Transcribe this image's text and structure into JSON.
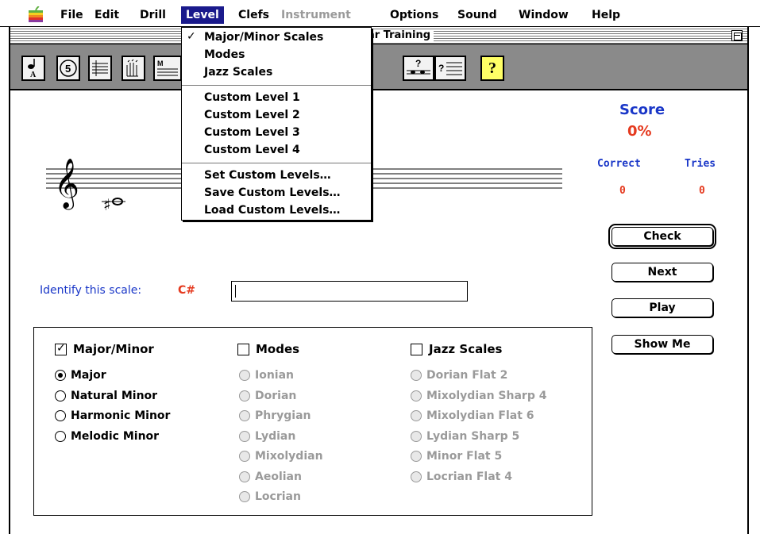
{
  "menubar": {
    "items": [
      {
        "label": "File",
        "state": "normal"
      },
      {
        "label": "Edit",
        "state": "normal"
      },
      {
        "label": "Drill",
        "state": "normal"
      },
      {
        "label": "Level",
        "state": "active"
      },
      {
        "label": "Clefs",
        "state": "normal"
      },
      {
        "label": "Instrument",
        "state": "disabled"
      },
      {
        "label": "Options",
        "state": "normal"
      },
      {
        "label": "Sound",
        "state": "normal"
      },
      {
        "label": "Window",
        "state": "normal"
      },
      {
        "label": "Help",
        "state": "normal"
      }
    ]
  },
  "window": {
    "title_visible": "ar Training"
  },
  "toolbar": {
    "icons": [
      "note-a-icon",
      "interval-5-icon",
      "chord-staff-icon",
      "hand-rhythm-icon",
      "scale-staff-icon",
      "question-staff-icon",
      "question-chord-icon",
      "help-icon"
    ],
    "help_glyph": "?"
  },
  "level_menu": {
    "checked": "Major/Minor Scales",
    "group1": [
      "Major/Minor Scales",
      "Modes",
      "Jazz Scales"
    ],
    "group2": [
      "Custom Level  1",
      "Custom Level  2",
      "Custom Level  3",
      "Custom Level  4"
    ],
    "group3": [
      "Set Custom Levels…",
      "Save Custom Levels…",
      "Load Custom Levels…"
    ]
  },
  "score": {
    "title": "Score",
    "percent": "0%",
    "correct_label": "Correct",
    "tries_label": "Tries",
    "correct": "0",
    "tries": "0"
  },
  "buttons": {
    "check": "Check",
    "next": "Next",
    "play": "Play",
    "show_me": "Show Me"
  },
  "prompt": {
    "label": "Identify this scale:",
    "note": "C#",
    "answer_value": ""
  },
  "categories": {
    "major_minor": {
      "label": "Major/Minor",
      "checked": true,
      "options": [
        "Major",
        "Natural Minor",
        "Harmonic Minor",
        "Melodic Minor"
      ],
      "selected": "Major"
    },
    "modes": {
      "label": "Modes",
      "checked": false,
      "options": [
        "Ionian",
        "Dorian",
        "Phrygian",
        "Lydian",
        "Mixolydian",
        "Aeolian",
        "Locrian"
      ]
    },
    "jazz": {
      "label": "Jazz Scales",
      "checked": false,
      "options": [
        "Dorian Flat 2",
        "Mixolydian Sharp 4",
        "Mixolydian Flat 6",
        "Lydian Sharp 5",
        "Minor Flat 5",
        "Locrian Flat 4"
      ]
    }
  },
  "colors": {
    "blue": "#1a37c8",
    "red": "#e53a1f",
    "menu_highlight": "#1a1a8c",
    "toolbar": "#8a8a8a",
    "help_button": "#ffff66",
    "disabled": "#9a9a9a"
  }
}
